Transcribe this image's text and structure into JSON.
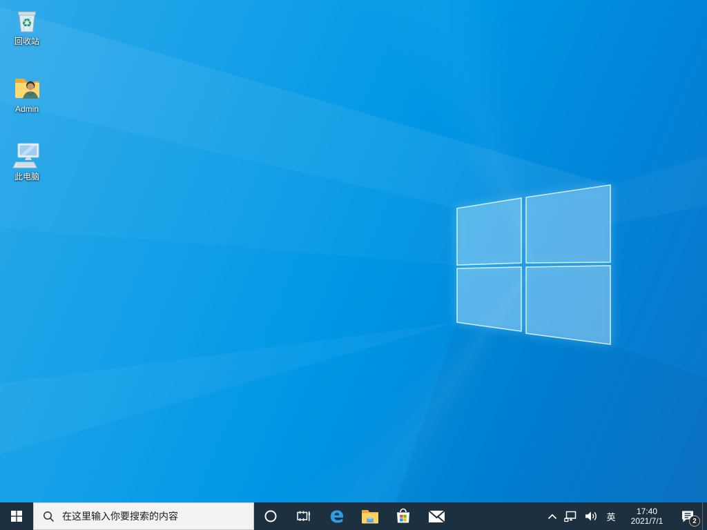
{
  "desktop": {
    "icons": [
      {
        "label": "回收站",
        "icon": "recycle-bin-icon",
        "glyph": "♻"
      },
      {
        "label": "Admin",
        "icon": "user-folder-icon"
      },
      {
        "label": "此电脑",
        "icon": "this-pc-icon"
      }
    ]
  },
  "taskbar": {
    "search": {
      "placeholder": "在这里输入你要搜索的内容",
      "icon": "search-icon"
    },
    "apps": [
      {
        "icon": "edge-icon",
        "glyph": "e"
      },
      {
        "icon": "file-explorer-icon"
      },
      {
        "icon": "store-icon"
      },
      {
        "icon": "mail-icon"
      }
    ],
    "tray": {
      "ime_label": "英",
      "clock": {
        "time": "17:40",
        "date": "2021/7/1"
      },
      "action_center": {
        "badge_count": "2"
      }
    }
  },
  "colors": {
    "taskbar_bg": "#1d3040",
    "wallpaper_left": "#2fa9e9",
    "wallpaper_mid": "#0096e4",
    "wallpaper_right": "#0d74c6",
    "logo_pane": "#48aee9",
    "search_bg": "#f3f3f3",
    "search_text": "#1a1a1a",
    "store_red": "#f25022",
    "store_green": "#7fba00",
    "store_blue": "#00a4ef",
    "store_yellow": "#ffb900"
  }
}
